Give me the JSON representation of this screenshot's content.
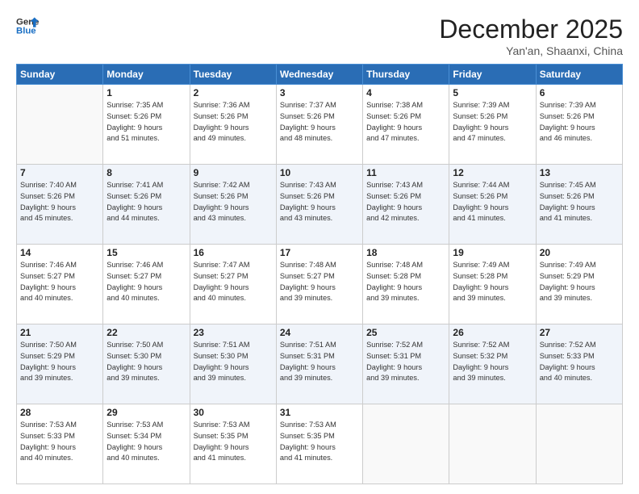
{
  "header": {
    "logo_line1": "General",
    "logo_line2": "Blue",
    "month_title": "December 2025",
    "location": "Yan'an, Shaanxi, China"
  },
  "days_of_week": [
    "Sunday",
    "Monday",
    "Tuesday",
    "Wednesday",
    "Thursday",
    "Friday",
    "Saturday"
  ],
  "weeks": [
    [
      {
        "day": "",
        "info": ""
      },
      {
        "day": "1",
        "info": "Sunrise: 7:35 AM\nSunset: 5:26 PM\nDaylight: 9 hours\nand 51 minutes."
      },
      {
        "day": "2",
        "info": "Sunrise: 7:36 AM\nSunset: 5:26 PM\nDaylight: 9 hours\nand 49 minutes."
      },
      {
        "day": "3",
        "info": "Sunrise: 7:37 AM\nSunset: 5:26 PM\nDaylight: 9 hours\nand 48 minutes."
      },
      {
        "day": "4",
        "info": "Sunrise: 7:38 AM\nSunset: 5:26 PM\nDaylight: 9 hours\nand 47 minutes."
      },
      {
        "day": "5",
        "info": "Sunrise: 7:39 AM\nSunset: 5:26 PM\nDaylight: 9 hours\nand 47 minutes."
      },
      {
        "day": "6",
        "info": "Sunrise: 7:39 AM\nSunset: 5:26 PM\nDaylight: 9 hours\nand 46 minutes."
      }
    ],
    [
      {
        "day": "7",
        "info": "Sunrise: 7:40 AM\nSunset: 5:26 PM\nDaylight: 9 hours\nand 45 minutes."
      },
      {
        "day": "8",
        "info": "Sunrise: 7:41 AM\nSunset: 5:26 PM\nDaylight: 9 hours\nand 44 minutes."
      },
      {
        "day": "9",
        "info": "Sunrise: 7:42 AM\nSunset: 5:26 PM\nDaylight: 9 hours\nand 43 minutes."
      },
      {
        "day": "10",
        "info": "Sunrise: 7:43 AM\nSunset: 5:26 PM\nDaylight: 9 hours\nand 43 minutes."
      },
      {
        "day": "11",
        "info": "Sunrise: 7:43 AM\nSunset: 5:26 PM\nDaylight: 9 hours\nand 42 minutes."
      },
      {
        "day": "12",
        "info": "Sunrise: 7:44 AM\nSunset: 5:26 PM\nDaylight: 9 hours\nand 41 minutes."
      },
      {
        "day": "13",
        "info": "Sunrise: 7:45 AM\nSunset: 5:26 PM\nDaylight: 9 hours\nand 41 minutes."
      }
    ],
    [
      {
        "day": "14",
        "info": "Sunrise: 7:46 AM\nSunset: 5:27 PM\nDaylight: 9 hours\nand 40 minutes."
      },
      {
        "day": "15",
        "info": "Sunrise: 7:46 AM\nSunset: 5:27 PM\nDaylight: 9 hours\nand 40 minutes."
      },
      {
        "day": "16",
        "info": "Sunrise: 7:47 AM\nSunset: 5:27 PM\nDaylight: 9 hours\nand 40 minutes."
      },
      {
        "day": "17",
        "info": "Sunrise: 7:48 AM\nSunset: 5:27 PM\nDaylight: 9 hours\nand 39 minutes."
      },
      {
        "day": "18",
        "info": "Sunrise: 7:48 AM\nSunset: 5:28 PM\nDaylight: 9 hours\nand 39 minutes."
      },
      {
        "day": "19",
        "info": "Sunrise: 7:49 AM\nSunset: 5:28 PM\nDaylight: 9 hours\nand 39 minutes."
      },
      {
        "day": "20",
        "info": "Sunrise: 7:49 AM\nSunset: 5:29 PM\nDaylight: 9 hours\nand 39 minutes."
      }
    ],
    [
      {
        "day": "21",
        "info": "Sunrise: 7:50 AM\nSunset: 5:29 PM\nDaylight: 9 hours\nand 39 minutes."
      },
      {
        "day": "22",
        "info": "Sunrise: 7:50 AM\nSunset: 5:30 PM\nDaylight: 9 hours\nand 39 minutes."
      },
      {
        "day": "23",
        "info": "Sunrise: 7:51 AM\nSunset: 5:30 PM\nDaylight: 9 hours\nand 39 minutes."
      },
      {
        "day": "24",
        "info": "Sunrise: 7:51 AM\nSunset: 5:31 PM\nDaylight: 9 hours\nand 39 minutes."
      },
      {
        "day": "25",
        "info": "Sunrise: 7:52 AM\nSunset: 5:31 PM\nDaylight: 9 hours\nand 39 minutes."
      },
      {
        "day": "26",
        "info": "Sunrise: 7:52 AM\nSunset: 5:32 PM\nDaylight: 9 hours\nand 39 minutes."
      },
      {
        "day": "27",
        "info": "Sunrise: 7:52 AM\nSunset: 5:33 PM\nDaylight: 9 hours\nand 40 minutes."
      }
    ],
    [
      {
        "day": "28",
        "info": "Sunrise: 7:53 AM\nSunset: 5:33 PM\nDaylight: 9 hours\nand 40 minutes."
      },
      {
        "day": "29",
        "info": "Sunrise: 7:53 AM\nSunset: 5:34 PM\nDaylight: 9 hours\nand 40 minutes."
      },
      {
        "day": "30",
        "info": "Sunrise: 7:53 AM\nSunset: 5:35 PM\nDaylight: 9 hours\nand 41 minutes."
      },
      {
        "day": "31",
        "info": "Sunrise: 7:53 AM\nSunset: 5:35 PM\nDaylight: 9 hours\nand 41 minutes."
      },
      {
        "day": "",
        "info": ""
      },
      {
        "day": "",
        "info": ""
      },
      {
        "day": "",
        "info": ""
      }
    ]
  ]
}
